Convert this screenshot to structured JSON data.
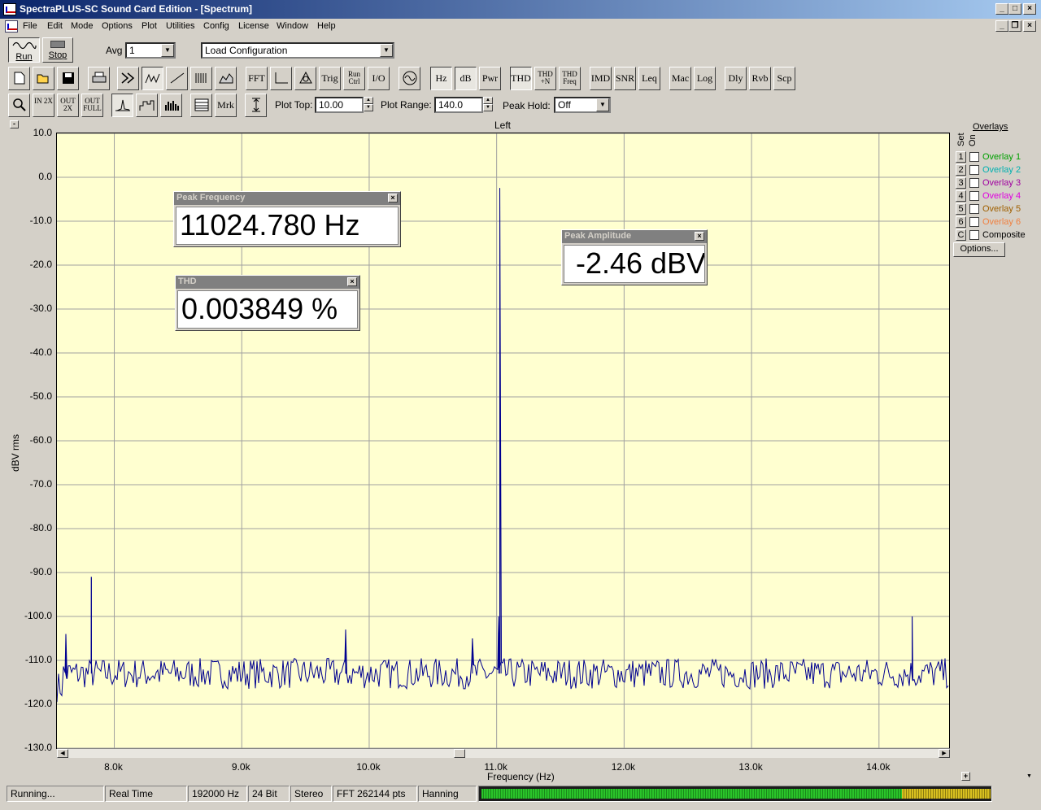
{
  "window": {
    "title": "SpectraPLUS-SC Sound Card Edition - [Spectrum]"
  },
  "menu": [
    "File",
    "Edit",
    "Mode",
    "Options",
    "Plot",
    "Utilities",
    "Config",
    "License",
    "Window",
    "Help"
  ],
  "toolbar1": {
    "run_label": "Run",
    "stop_label": "Stop",
    "avg_label": "Avg",
    "avg_value": "1",
    "config_value": "Load Configuration"
  },
  "toolbar2": {
    "buttons": [
      "FFT",
      "Trig",
      "Run Ctrl",
      "I/O",
      "Hz",
      "dB",
      "Pwr",
      "THD",
      "THD +N",
      "THD Freq",
      "IMD",
      "SNR",
      "Leq",
      "Mac",
      "Log",
      "Dly",
      "Rvb",
      "Scp"
    ]
  },
  "toolbar3": {
    "zoom_in_label": "IN 2X",
    "zoom_out_label": "OUT 2X",
    "zoom_full_label": "OUT FULL",
    "mrk_label": "Mrk",
    "plot_top_label": "Plot Top:",
    "plot_top_value": "10.00",
    "plot_range_label": "Plot Range:",
    "plot_range_value": "140.0",
    "peak_hold_label": "Peak Hold:",
    "peak_hold_value": "Off"
  },
  "plot": {
    "channel_label": "Left",
    "collapse_glyph": "-",
    "expand_glyph": "+"
  },
  "widgets": {
    "peak_frequency": {
      "title": "Peak Frequency",
      "value": "11024.780 Hz"
    },
    "thd": {
      "title": "THD",
      "value": "0.003849 %"
    },
    "peak_amplitude": {
      "title": "Peak Amplitude",
      "value": "-2.46 dBV"
    }
  },
  "overlays": {
    "header": "Overlays",
    "set_label": "Set",
    "on_label": "On",
    "items": [
      {
        "num": "1",
        "label": "Overlay 1",
        "color": "#00a000"
      },
      {
        "num": "2",
        "label": "Overlay 2",
        "color": "#00b0b0"
      },
      {
        "num": "3",
        "label": "Overlay 3",
        "color": "#a000a0"
      },
      {
        "num": "4",
        "label": "Overlay 4",
        "color": "#e000e0"
      },
      {
        "num": "5",
        "label": "Overlay 5",
        "color": "#a06000"
      },
      {
        "num": "6",
        "label": "Overlay 6",
        "color": "#f08040"
      },
      {
        "num": "C",
        "label": "Composite",
        "color": "#000000"
      }
    ],
    "options_label": "Options..."
  },
  "status": {
    "state": "Running...",
    "mode": "Real Time",
    "sample_rate": "192000 Hz",
    "bits": "24 Bit",
    "channels": "Stereo",
    "fft_size": "FFT 262144 pts",
    "window": "Hanning"
  },
  "chart_data": {
    "type": "line",
    "title": "Left",
    "xlabel": "Frequency (Hz)",
    "ylabel": "dBV rms",
    "xlim": [
      7550,
      14550
    ],
    "ylim": [
      -130,
      10
    ],
    "grid": true,
    "line_color": "#000090",
    "x_ticks": [
      "8.0k",
      "9.0k",
      "10.0k",
      "11.0k",
      "12.0k",
      "13.0k",
      "14.0k"
    ],
    "x_tick_values": [
      8000,
      9000,
      10000,
      11000,
      12000,
      13000,
      14000
    ],
    "y_ticks": [
      "10.0",
      "0.0",
      "-10.0",
      "-20.0",
      "-30.0",
      "-40.0",
      "-50.0",
      "-60.0",
      "-70.0",
      "-80.0",
      "-90.0",
      "-100.0",
      "-110.0",
      "-120.0",
      "-130.0"
    ],
    "y_tick_values": [
      10,
      0,
      -10,
      -20,
      -30,
      -40,
      -50,
      -60,
      -70,
      -80,
      -90,
      -100,
      -110,
      -120,
      -130
    ],
    "noise_floor_db": -113,
    "series": [
      {
        "x": [
          7550,
          7610,
          7620,
          7630,
          7780,
          7820,
          7830,
          7900,
          8000,
          8100,
          8200,
          8300,
          8400,
          8500,
          8600,
          8700,
          8800,
          8900,
          9000,
          9100,
          9200,
          9300,
          9400,
          9500,
          9600,
          9700,
          9800,
          9815,
          9830,
          9900,
          10000,
          10100,
          10200,
          10300,
          10400,
          10500,
          10600,
          10700,
          10800,
          10810,
          10820,
          11000,
          11015,
          11024.78,
          11035,
          11050,
          11100,
          11200,
          11300,
          11400,
          11500,
          11600,
          11700,
          11800,
          11900,
          12000,
          12100,
          12200,
          12300,
          12400,
          12500,
          12600,
          12700,
          12800,
          12900,
          13000,
          13100,
          13200,
          13300,
          13400,
          13500,
          13600,
          13700,
          13800,
          13900,
          14000,
          14100,
          14200,
          14250,
          14260,
          14270,
          14300,
          14400,
          14500,
          14550
        ],
        "y": [
          -118,
          -114,
          -104,
          -113,
          -113,
          -91,
          -113,
          -113,
          -112,
          -114,
          -113,
          -112,
          -115,
          -113,
          -112,
          -114,
          -113,
          -112,
          -113,
          -114,
          -112,
          -113,
          -114,
          -113,
          -112,
          -113,
          -113,
          -103,
          -113,
          -114,
          -113,
          -112,
          -114,
          -113,
          -112,
          -114,
          -113,
          -112,
          -113,
          -105,
          -113,
          -113,
          -100,
          -2.46,
          -100,
          -113,
          -114,
          -112,
          -113,
          -114,
          -113,
          -112,
          -114,
          -113,
          -112,
          -113,
          -114,
          -113,
          -112,
          -114,
          -113,
          -112,
          -113,
          -114,
          -113,
          -112,
          -114,
          -113,
          -112,
          -113,
          -114,
          -113,
          -112,
          -114,
          -113,
          -112,
          -113,
          -114,
          -113,
          -100,
          -113,
          -112,
          -114,
          -113,
          -113
        ]
      }
    ]
  }
}
